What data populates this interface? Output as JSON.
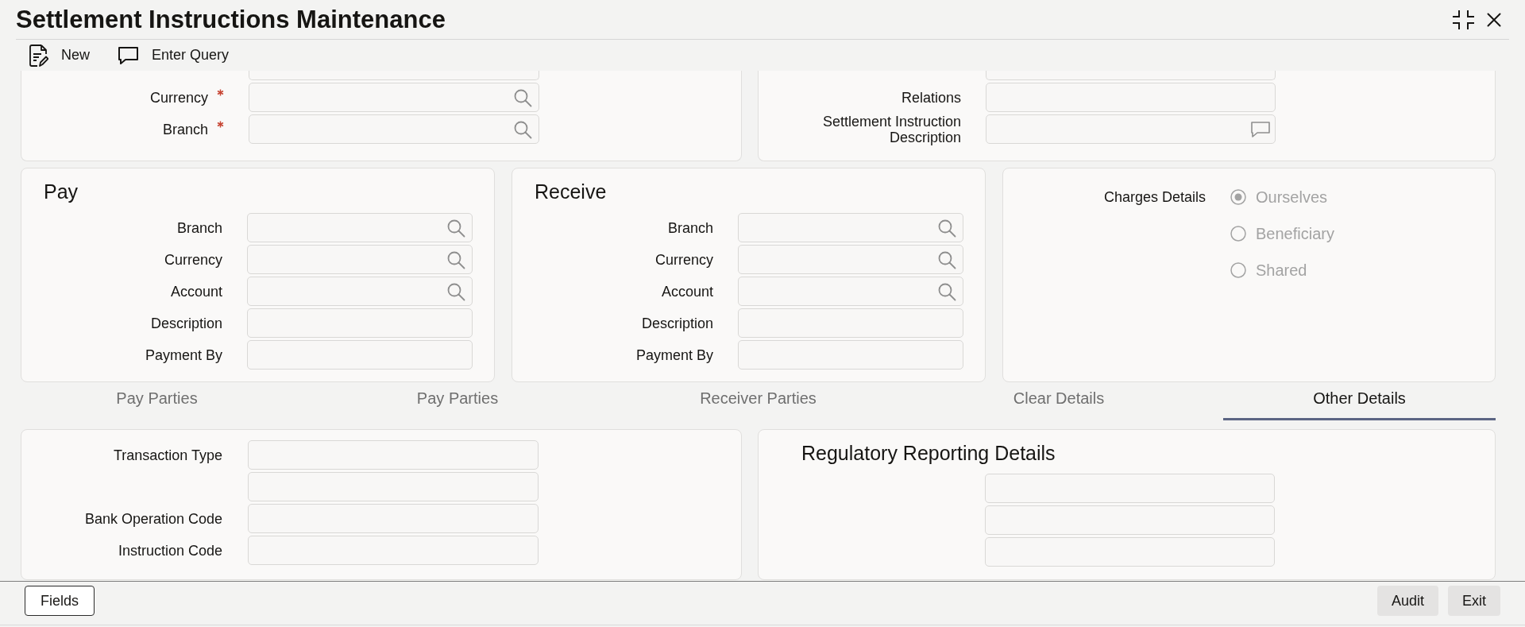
{
  "window": {
    "title": "Settlement Instructions Maintenance"
  },
  "toolbar": [
    {
      "kind": "new",
      "label": "New"
    },
    {
      "kind": "query",
      "label": "Enter Query"
    }
  ],
  "header_left": {
    "fields": [
      {
        "label": "Currency",
        "kind": "lookup",
        "required": true
      },
      {
        "label": "Branch",
        "kind": "lookup",
        "required": true
      }
    ]
  },
  "header_right": {
    "fields": [
      {
        "label": "Relations",
        "kind": "text"
      },
      {
        "label": "Settlement Instruction Description",
        "kind": "note"
      }
    ]
  },
  "pay": {
    "title": "Pay",
    "fields": [
      {
        "label": "Branch",
        "kind": "lookup"
      },
      {
        "label": "Currency",
        "kind": "lookup"
      },
      {
        "label": "Account",
        "kind": "lookup"
      },
      {
        "label": "Description",
        "kind": "text"
      },
      {
        "label": "Payment By",
        "kind": "text"
      }
    ]
  },
  "receive": {
    "title": "Receive",
    "fields": [
      {
        "label": "Branch",
        "kind": "lookup"
      },
      {
        "label": "Currency",
        "kind": "lookup"
      },
      {
        "label": "Account",
        "kind": "lookup"
      },
      {
        "label": "Description",
        "kind": "text"
      },
      {
        "label": "Payment By",
        "kind": "text"
      }
    ]
  },
  "charges": {
    "label": "Charges Details",
    "disabled": true,
    "options": [
      {
        "label": "Ourselves",
        "selected": true
      },
      {
        "label": "Beneficiary",
        "selected": false
      },
      {
        "label": "Shared",
        "selected": false
      }
    ]
  },
  "tabs": [
    {
      "label": "Pay Parties",
      "selected": false
    },
    {
      "label": "Pay Parties",
      "selected": false
    },
    {
      "label": "Receiver Parties",
      "selected": false
    },
    {
      "label": "Clear Details",
      "selected": false
    },
    {
      "label": "Other Details",
      "selected": true
    }
  ],
  "other_details": {
    "fields": [
      {
        "label": "Transaction Type",
        "kind": "text"
      },
      {
        "kind": "text"
      },
      {
        "label": "Bank Operation Code",
        "kind": "text"
      },
      {
        "label": "Instruction Code",
        "kind": "text"
      }
    ]
  },
  "regulatory_reporting": {
    "title": "Regulatory Reporting Details",
    "fields": [
      {
        "kind": "text"
      },
      {
        "kind": "text"
      },
      {
        "kind": "text"
      }
    ]
  },
  "footer": {
    "left_buttons": [
      {
        "label": "Fields"
      }
    ],
    "right_buttons": [
      {
        "label": "Audit"
      },
      {
        "label": "Exit"
      }
    ]
  }
}
